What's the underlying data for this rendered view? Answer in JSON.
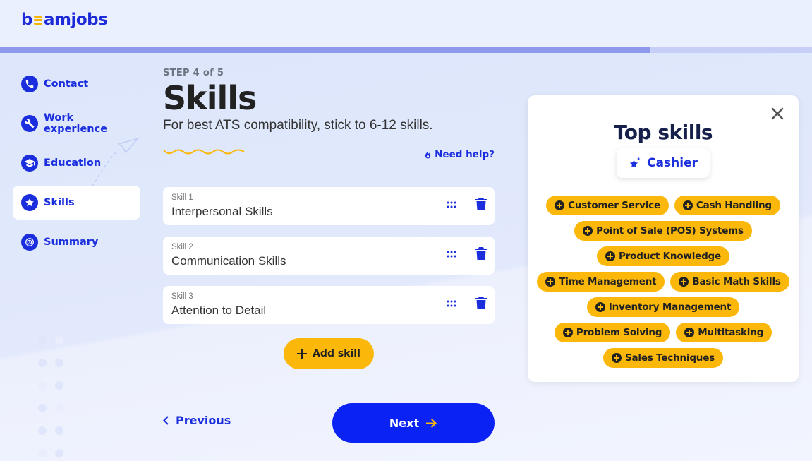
{
  "app": {
    "logo_text": "beamjobs",
    "progress_percent": 80,
    "colors": {
      "primary": "#1a2ede",
      "accent": "#fbb80b",
      "next_button": "#0b22f5"
    }
  },
  "sidebar": {
    "items": [
      {
        "label": "Contact",
        "icon": "phone-icon",
        "active": false
      },
      {
        "label": "Work experience",
        "icon": "wrench-icon",
        "active": false
      },
      {
        "label": "Education",
        "icon": "graduation-cap-icon",
        "active": false
      },
      {
        "label": "Skills",
        "icon": "star-icon",
        "active": true
      },
      {
        "label": "Summary",
        "icon": "target-icon",
        "active": false
      }
    ]
  },
  "main": {
    "step": "STEP 4 of 5",
    "title": "Skills",
    "subtitle": "For best ATS compatibility, stick to 6-12 skills.",
    "help_label": "Need help?",
    "skills": [
      {
        "label": "Skill 1",
        "value": "Interpersonal Skills"
      },
      {
        "label": "Skill 2",
        "value": "Communication Skills"
      },
      {
        "label": "Skill 3",
        "value": "Attention to Detail"
      }
    ],
    "add_skill_label": "Add skill",
    "previous_label": "Previous",
    "next_label": "Next"
  },
  "panel": {
    "title": "Top skills",
    "job": "Cashier",
    "chip_rows": [
      [
        "Customer Service",
        "Cash Handling"
      ],
      [
        "Point of Sale (POS) Systems"
      ],
      [
        "Product Knowledge"
      ],
      [
        "Time Management",
        "Basic Math Skills"
      ],
      [
        "Inventory Management"
      ],
      [
        "Problem Solving",
        "Multitasking"
      ],
      [
        "Sales Techniques"
      ]
    ]
  }
}
